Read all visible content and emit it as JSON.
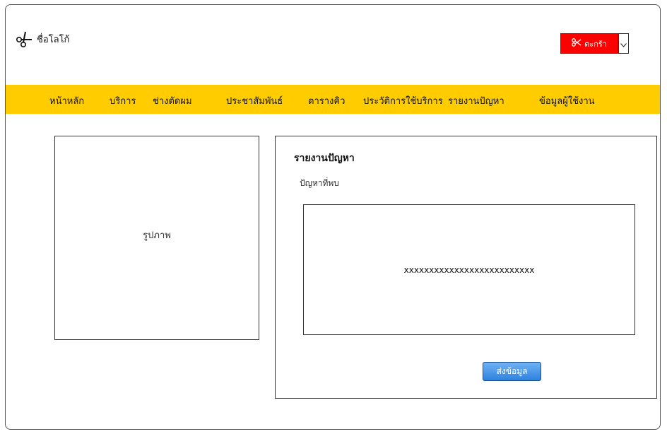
{
  "header": {
    "logo_icon": "scissors-icon",
    "logo_text": "ชื่อโลโก้",
    "cart": {
      "icon": "scissors-icon",
      "label": "ตะกร้า",
      "dropdown_icon": "chevron-down-icon",
      "color": "#ff0000"
    }
  },
  "nav": {
    "background": "#ffcc00",
    "items": [
      "หน้าหลัก",
      "บริการ",
      "ช่างตัดผม",
      "ประชาสัมพันธ์",
      "ตารางคิว",
      "ประวัติการใช้บริการ",
      "รายงานปัญหา",
      "ข้อมูลผู้ใช้งาน"
    ]
  },
  "main": {
    "image_placeholder": "รูปภาพ",
    "report": {
      "title": "รายงานปัญหา",
      "field_label": "ปัญหาที่พบ",
      "field_value": "xxxxxxxxxxxxxxxxxxxxxxxxxx",
      "submit_label": "ส่งข้อมูล"
    }
  }
}
